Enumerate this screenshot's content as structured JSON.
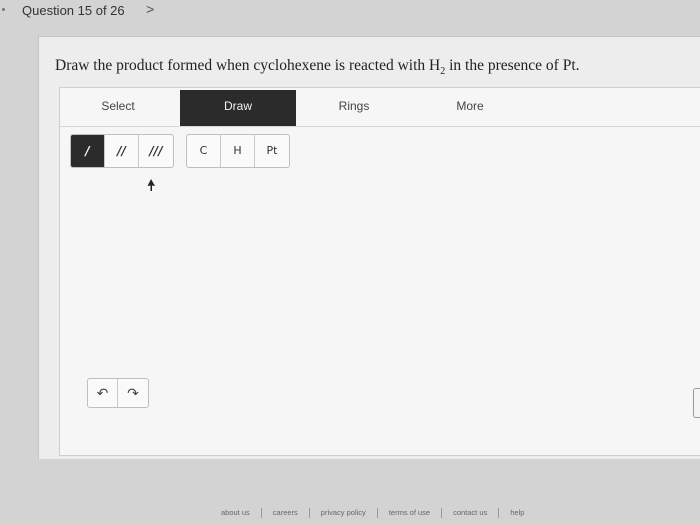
{
  "nav": {
    "question_label": "Question 15 of 26",
    "next_glyph": ">"
  },
  "question": {
    "prompt_before": "Draw the product formed when cyclohexene is reacted with H",
    "prompt_sub": "2",
    "prompt_after": " in the presence of Pt."
  },
  "editor": {
    "modes": [
      {
        "label": "Select",
        "active": false
      },
      {
        "label": "Draw",
        "active": true
      },
      {
        "label": "Rings",
        "active": false
      },
      {
        "label": "More",
        "active": false
      }
    ],
    "bond_tools": [
      {
        "label": "/",
        "active": true
      },
      {
        "label": "//",
        "active": false
      },
      {
        "label": "///",
        "active": false
      }
    ],
    "atom_tools": [
      "C",
      "H",
      "Pt"
    ],
    "history": {
      "undo_glyph": "↶",
      "redo_glyph": "↷"
    }
  },
  "footer": {
    "links": [
      "about us",
      "careers",
      "privacy policy",
      "terms of use",
      "contact us",
      "help"
    ]
  },
  "colors": {
    "active_bg": "#2b2b2b",
    "page_bg": "#d3d3d3",
    "panel_bg": "#f6f6f6"
  }
}
